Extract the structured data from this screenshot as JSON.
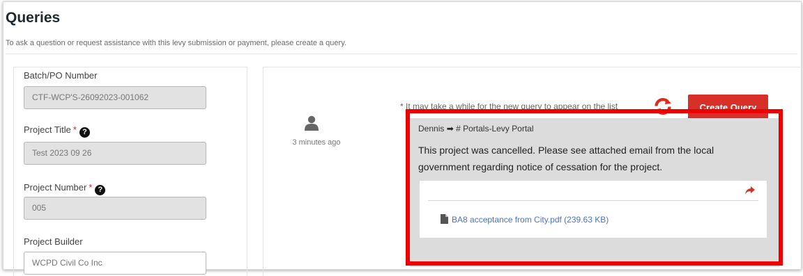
{
  "page": {
    "title": "Queries",
    "intro": "To ask a question or request assistance with this levy submission or payment, please create a query."
  },
  "form": {
    "batch": {
      "label": "Batch/PO Number",
      "value": "CTF-WCP'S-26092023-001062"
    },
    "project_title": {
      "label": "Project Title",
      "required_mark": "*",
      "help": "?",
      "value": "Test 2023 09 26"
    },
    "project_number": {
      "label": "Project Number",
      "required_mark": "*",
      "help": "?",
      "value": "005"
    },
    "project_builder": {
      "label": "Project Builder",
      "value": "WCPD Civil Co Inc"
    }
  },
  "queries": {
    "hint": "* It may take a while for the new query to appear on the list",
    "refresh_icon": "refresh-icon",
    "create_label": "Create Query",
    "message": {
      "avatar_icon": "user-icon",
      "time": "3 minutes ago",
      "sender": "Dennis",
      "arrow": "➡",
      "channel": "# Portals-Levy Portal",
      "body": "This project was cancelled. Please see attached email from the local government regarding notice of cessation for the project.",
      "share_icon": "share-icon",
      "attachment_icon": "file-icon",
      "attachment": "BA8 acceptance from City.pdf (239.63 KB)"
    }
  },
  "colors": {
    "accent": "#d73028",
    "highlight": "#ee0000",
    "link": "#4a72c4",
    "card": "#dcdcdc"
  }
}
